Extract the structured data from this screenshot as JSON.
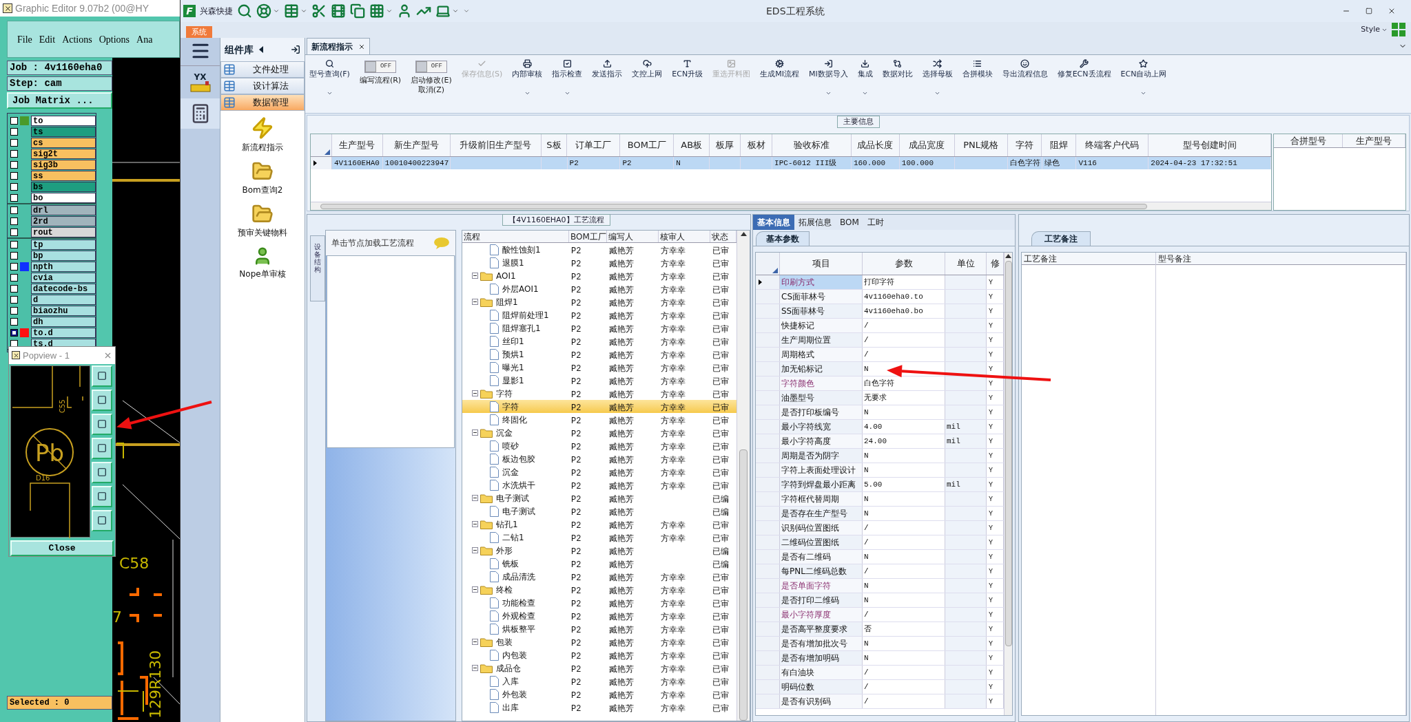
{
  "editor": {
    "title": "Graphic Editor 9.07b2 (00@HY",
    "menu": [
      "File",
      "Edit",
      "Actions",
      "Options",
      "Ana"
    ],
    "job": "Job : 4v1160eha0",
    "step": "Step: cam",
    "matrix_button": "Job Matrix ...",
    "layer_groups": [
      [
        {
          "name": "to",
          "color": "#ffffff",
          "marker": {
            "color": "#4a9a2a"
          },
          "checked": false
        },
        {
          "name": "ts",
          "color": "#1e9e80",
          "checked": false
        },
        {
          "name": "cs",
          "color": "#f8c060",
          "checked": false
        },
        {
          "name": "sig2t",
          "color": "#f8c060",
          "checked": false
        },
        {
          "name": "sig3b",
          "color": "#f8c060",
          "checked": false
        },
        {
          "name": "ss",
          "color": "#f8c060",
          "checked": false
        },
        {
          "name": "bs",
          "color": "#1e9e80",
          "checked": false
        },
        {
          "name": "bo",
          "color": "#ffffff",
          "checked": false
        }
      ],
      [
        {
          "name": "drl",
          "color": "#a0b4bc",
          "checked": false
        },
        {
          "name": "2rd",
          "color": "#a0b4bc",
          "checked": false
        },
        {
          "name": "rout",
          "color": "#d8d8d8",
          "checked": false
        }
      ],
      [
        {
          "name": "tp",
          "color": "#a8e0e0",
          "checked": false
        },
        {
          "name": "bp",
          "color": "#a8e0e0",
          "checked": false
        },
        {
          "name": "npth",
          "color": "#a8e0e0",
          "marker": {
            "color": "#1030ff"
          },
          "checked": false
        },
        {
          "name": "cvia",
          "color": "#a8e0e0",
          "checked": false
        },
        {
          "name": "datecode-bs",
          "color": "#a8e0e0",
          "checked": false
        },
        {
          "name": "d",
          "color": "#a8e0e0",
          "checked": false
        },
        {
          "name": "biaozhu",
          "color": "#a8e0e0",
          "checked": false
        },
        {
          "name": "dh",
          "color": "#a8e0e0",
          "checked": false
        },
        {
          "name": "to.d",
          "color": "#a8e0e0",
          "marker": {
            "color": "#ff1010"
          },
          "checked": true
        },
        {
          "name": "ts.d",
          "color": "#a8e0e0",
          "checked": false
        }
      ]
    ],
    "canvas_labels": [
      "C58",
      "7",
      "129R130"
    ],
    "popview": {
      "title": "Popview - 1",
      "labels": [
        "C55",
        "D16"
      ],
      "symbol": "Pb",
      "close": "Close"
    },
    "status": "Selected : 0"
  },
  "app": {
    "logo_letter": "F",
    "quick_label": "兴森快捷",
    "title": "EDS工程系统",
    "system_tab": "系统",
    "style_menu": "Style",
    "nav_logo_text": "YX"
  },
  "library": {
    "title": "组件库",
    "categories": [
      {
        "label": "文件处理",
        "selected": false
      },
      {
        "label": "设计算法",
        "selected": false
      },
      {
        "label": "数据管理",
        "selected": true
      }
    ],
    "items": [
      "新流程指示",
      "Bom查询2",
      "预审关键物料",
      "Nope单审核"
    ]
  },
  "doc_tabs": [
    {
      "label": "新流程指示",
      "selected": true
    }
  ],
  "ribbon": [
    {
      "kind": "button",
      "label": "型号查询(F)",
      "dropdown": true,
      "disabled": false
    },
    {
      "kind": "toggle",
      "label": "编写流程(R)",
      "state": "OFF",
      "on": false
    },
    {
      "kind": "toggle",
      "label": "启动修改(E)",
      "sub": "取消(Z)",
      "state": "OFF",
      "on": false
    },
    {
      "kind": "button",
      "label": "保存信息(S)",
      "dropdown": false,
      "disabled": true
    },
    {
      "kind": "button",
      "label": "内部审核",
      "dropdown": true,
      "disabled": false
    },
    {
      "kind": "button",
      "label": "指示检查",
      "dropdown": true,
      "disabled": false
    },
    {
      "kind": "button",
      "label": "发送指示",
      "dropdown": false,
      "disabled": false
    },
    {
      "kind": "button",
      "label": "文控上网",
      "dropdown": false,
      "disabled": false
    },
    {
      "kind": "button",
      "label": "ECN升级",
      "dropdown": false,
      "disabled": false
    },
    {
      "kind": "button",
      "label": "重选开料图",
      "dropdown": false,
      "disabled": true
    },
    {
      "kind": "button",
      "label": "生成MI流程",
      "dropdown": false,
      "disabled": false
    },
    {
      "kind": "button",
      "label": "MI数据导入",
      "dropdown": true,
      "disabled": false
    },
    {
      "kind": "button",
      "label": "集成",
      "dropdown": true,
      "disabled": false
    },
    {
      "kind": "button",
      "label": "数据对比",
      "dropdown": false,
      "disabled": false
    },
    {
      "kind": "button",
      "label": "选择母板",
      "dropdown": true,
      "disabled": false
    },
    {
      "kind": "button",
      "label": "合拼模块",
      "dropdown": false,
      "disabled": false
    },
    {
      "kind": "button",
      "label": "导出流程信息",
      "dropdown": false,
      "disabled": false
    },
    {
      "kind": "button",
      "label": "修复ECN丢流程",
      "dropdown": false,
      "disabled": false
    },
    {
      "kind": "button",
      "label": "ECN自动上网",
      "dropdown": true,
      "disabled": false
    }
  ],
  "main_info": {
    "title": "主要信息",
    "columns": [
      "生产型号",
      "新生产型号",
      "升级前旧生产型号",
      "S板",
      "订单工厂",
      "BOM工厂",
      "AB板",
      "板厚",
      "板材",
      "验收标准",
      "成品长度",
      "成品宽度",
      "PNL规格",
      "字符",
      "阻焊",
      "终端客户代码",
      "型号创建时间"
    ],
    "rows": [
      {
        "selected": true,
        "cells": [
          "4V1160EHA0",
          "10010400223947",
          null,
          null,
          "P2",
          "P2",
          "N",
          null,
          null,
          "IPC-6012 III级",
          "160.000",
          "100.000",
          null,
          "白色字符",
          "绿色",
          "V116",
          "2024-04-23 17:32:51"
        ]
      }
    ],
    "side_columns": [
      "合拼型号",
      "生产型号"
    ]
  },
  "flow": {
    "title": "【4V1160EHA0】工艺流程",
    "side_tab": "设备结构",
    "hint": "单击节点加载工艺流程",
    "columns": [
      "流程",
      "BOM工厂",
      "编写人",
      "核审人",
      "状态"
    ],
    "tree": [
      {
        "kind": "continued",
        "children": [
          {
            "kind": "doc",
            "name": "酸性蚀刻1",
            "factory": "P2",
            "writer": "臧艳芳",
            "reviewer": "方幸幸",
            "status": "已审",
            "selected": false
          },
          {
            "kind": "doc",
            "name": "退膜1",
            "factory": "P2",
            "writer": "臧艳芳",
            "reviewer": "方幸幸",
            "status": "已审",
            "selected": false
          }
        ]
      },
      {
        "kind": "folder",
        "name": "AOI1",
        "factory": "P2",
        "writer": "臧艳芳",
        "reviewer": "方幸幸",
        "status": "已审",
        "selected": false,
        "expanded": true,
        "children": [
          {
            "kind": "doc",
            "name": "外层AOI1",
            "factory": "P2",
            "writer": "臧艳芳",
            "reviewer": "方幸幸",
            "status": "已审",
            "selected": false
          }
        ]
      },
      {
        "kind": "folder",
        "name": "阻焊1",
        "factory": "P2",
        "writer": "臧艳芳",
        "reviewer": "方幸幸",
        "status": "已审",
        "selected": false,
        "expanded": true,
        "children": [
          {
            "kind": "doc",
            "name": "阻焊前处理1",
            "factory": "P2",
            "writer": "臧艳芳",
            "reviewer": "方幸幸",
            "status": "已审",
            "selected": false
          },
          {
            "kind": "doc",
            "name": "阻焊塞孔1",
            "factory": "P2",
            "writer": "臧艳芳",
            "reviewer": "方幸幸",
            "status": "已审",
            "selected": false
          },
          {
            "kind": "doc",
            "name": "丝印1",
            "factory": "P2",
            "writer": "臧艳芳",
            "reviewer": "方幸幸",
            "status": "已审",
            "selected": false
          },
          {
            "kind": "doc",
            "name": "预烘1",
            "factory": "P2",
            "writer": "臧艳芳",
            "reviewer": "方幸幸",
            "status": "已审",
            "selected": false
          },
          {
            "kind": "doc",
            "name": "曝光1",
            "factory": "P2",
            "writer": "臧艳芳",
            "reviewer": "方幸幸",
            "status": "已审",
            "selected": false
          },
          {
            "kind": "doc",
            "name": "显影1",
            "factory": "P2",
            "writer": "臧艳芳",
            "reviewer": "方幸幸",
            "status": "已审",
            "selected": false
          }
        ]
      },
      {
        "kind": "folder",
        "name": "字符",
        "factory": "P2",
        "writer": "臧艳芳",
        "reviewer": "方幸幸",
        "status": "已审",
        "selected": false,
        "expanded": true,
        "children": [
          {
            "kind": "doc",
            "name": "字符",
            "factory": "P2",
            "writer": "臧艳芳",
            "reviewer": "方幸幸",
            "status": "已审",
            "selected": true
          },
          {
            "kind": "doc",
            "name": "终固化",
            "factory": "P2",
            "writer": "臧艳芳",
            "reviewer": "方幸幸",
            "status": "已审",
            "selected": false
          }
        ]
      },
      {
        "kind": "folder",
        "name": "沉金",
        "factory": "P2",
        "writer": "臧艳芳",
        "reviewer": "方幸幸",
        "status": "已审",
        "selected": false,
        "expanded": true,
        "children": [
          {
            "kind": "doc",
            "name": "喷砂",
            "factory": "P2",
            "writer": "臧艳芳",
            "reviewer": "方幸幸",
            "status": "已审",
            "selected": false
          },
          {
            "kind": "doc",
            "name": "板边包胶",
            "factory": "P2",
            "writer": "臧艳芳",
            "reviewer": "方幸幸",
            "status": "已审",
            "selected": false
          },
          {
            "kind": "doc",
            "name": "沉金",
            "factory": "P2",
            "writer": "臧艳芳",
            "reviewer": "方幸幸",
            "status": "已审",
            "selected": false
          },
          {
            "kind": "doc",
            "name": "水洗烘干",
            "factory": "P2",
            "writer": "臧艳芳",
            "reviewer": "方幸幸",
            "status": "已审",
            "selected": false
          }
        ]
      },
      {
        "kind": "folder",
        "name": "电子测试",
        "factory": "P2",
        "writer": "臧艳芳",
        "status": "已编",
        "selected": false,
        "expanded": true,
        "children": [
          {
            "kind": "doc",
            "name": "电子测试",
            "factory": "P2",
            "writer": "臧艳芳",
            "status": "已编",
            "selected": false
          }
        ]
      },
      {
        "kind": "folder",
        "name": "钻孔1",
        "factory": "P2",
        "writer": "臧艳芳",
        "reviewer": "方幸幸",
        "status": "已审",
        "selected": false,
        "expanded": true,
        "children": [
          {
            "kind": "doc",
            "name": "二钻1",
            "factory": "P2",
            "writer": "臧艳芳",
            "reviewer": "方幸幸",
            "status": "已审",
            "selected": false
          }
        ]
      },
      {
        "kind": "folder",
        "name": "外形",
        "factory": "P2",
        "writer": "臧艳芳",
        "status": "已编",
        "selected": false,
        "expanded": true,
        "children": [
          {
            "kind": "doc",
            "name": "铣板",
            "factory": "P2",
            "writer": "臧艳芳",
            "status": "已编",
            "selected": false
          },
          {
            "kind": "doc",
            "name": "成品清洗",
            "factory": "P2",
            "writer": "臧艳芳",
            "reviewer": "方幸幸",
            "status": "已审",
            "selected": false
          }
        ]
      },
      {
        "kind": "folder",
        "name": "终检",
        "factory": "P2",
        "writer": "臧艳芳",
        "reviewer": "方幸幸",
        "status": "已审",
        "selected": false,
        "expanded": true,
        "children": [
          {
            "kind": "doc",
            "name": "功能检查",
            "factory": "P2",
            "writer": "臧艳芳",
            "reviewer": "方幸幸",
            "status": "已审",
            "selected": false
          },
          {
            "kind": "doc",
            "name": "外观检查",
            "factory": "P2",
            "writer": "臧艳芳",
            "reviewer": "方幸幸",
            "status": "已审",
            "selected": false
          },
          {
            "kind": "doc",
            "name": "烘板整平",
            "factory": "P2",
            "writer": "臧艳芳",
            "reviewer": "方幸幸",
            "status": "已审",
            "selected": false
          }
        ]
      },
      {
        "kind": "folder",
        "name": "包装",
        "factory": "P2",
        "writer": "臧艳芳",
        "reviewer": "方幸幸",
        "status": "已审",
        "selected": false,
        "expanded": true,
        "children": [
          {
            "kind": "doc",
            "name": "内包装",
            "factory": "P2",
            "writer": "臧艳芳",
            "reviewer": "方幸幸",
            "status": "已审",
            "selected": false
          }
        ]
      },
      {
        "kind": "folder",
        "name": "成品仓",
        "factory": "P2",
        "writer": "臧艳芳",
        "reviewer": "方幸幸",
        "status": "已审",
        "selected": false,
        "expanded": true,
        "children": [
          {
            "kind": "doc",
            "name": "入库",
            "factory": "P2",
            "writer": "臧艳芳",
            "reviewer": "方幸幸",
            "status": "已审",
            "selected": false
          },
          {
            "kind": "doc",
            "name": "外包装",
            "factory": "P2",
            "writer": "臧艳芳",
            "reviewer": "方幸幸",
            "status": "已审",
            "selected": false
          },
          {
            "kind": "doc",
            "name": "出库",
            "factory": "P2",
            "writer": "臧艳芳",
            "reviewer": "方幸幸",
            "status": "已审",
            "selected": false
          }
        ]
      }
    ]
  },
  "info": {
    "tabs": [
      {
        "label": "基本信息",
        "selected": true
      },
      {
        "label": "拓展信息",
        "selected": false
      },
      {
        "label": "BOM",
        "selected": false
      },
      {
        "label": "工时",
        "selected": false
      }
    ],
    "subtab": "基本参数",
    "columns": [
      "项目",
      "参数",
      "单位",
      "修"
    ],
    "rows": [
      {
        "item": "印刷方式",
        "value": "打印字符",
        "flag": "Y",
        "highlight": true,
        "selected": true
      },
      {
        "item": "CS面菲林号",
        "value": "4v1160eha0.to",
        "flag": "Y",
        "highlight": false,
        "selected": false
      },
      {
        "item": "SS面菲林号",
        "value": "4v1160eha0.bo",
        "flag": "Y",
        "highlight": false,
        "selected": false
      },
      {
        "item": "快捷标记",
        "value": "/",
        "flag": "Y",
        "highlight": false,
        "selected": false
      },
      {
        "item": "生产周期位置",
        "value": "/",
        "flag": "Y",
        "highlight": false,
        "selected": false
      },
      {
        "item": "周期格式",
        "value": "/",
        "flag": "Y",
        "highlight": false,
        "selected": false
      },
      {
        "item": "加无铅标记",
        "value": "N",
        "flag": "Y",
        "highlight": false,
        "selected": false
      },
      {
        "item": "字符颜色",
        "value": "白色字符",
        "flag": "Y",
        "highlight": true,
        "selected": false
      },
      {
        "item": "油墨型号",
        "value": "无要求",
        "flag": "Y",
        "highlight": false,
        "selected": false
      },
      {
        "item": "是否打印板编号",
        "value": "N",
        "flag": "Y",
        "highlight": false,
        "selected": false
      },
      {
        "item": "最小字符线宽",
        "value": "4.00",
        "unit": "mil",
        "flag": "Y",
        "highlight": false,
        "selected": false
      },
      {
        "item": "最小字符高度",
        "value": "24.00",
        "unit": "mil",
        "flag": "Y",
        "highlight": false,
        "selected": false
      },
      {
        "item": "周期是否为阴字",
        "value": "N",
        "flag": "Y",
        "highlight": false,
        "selected": false
      },
      {
        "item": "字符上表面处理设计",
        "value": "N",
        "flag": "Y",
        "highlight": false,
        "selected": false
      },
      {
        "item": "字符到焊盘最小距离",
        "value": "5.00",
        "unit": "mil",
        "flag": "Y",
        "highlight": false,
        "selected": false
      },
      {
        "item": "字符框代替周期",
        "value": "N",
        "flag": "Y",
        "highlight": false,
        "selected": false
      },
      {
        "item": "是否存在生产型号",
        "value": "N",
        "flag": "Y",
        "highlight": false,
        "selected": false
      },
      {
        "item": "识别码位置图纸",
        "value": "/",
        "flag": "Y",
        "highlight": false,
        "selected": false
      },
      {
        "item": "二维码位置图纸",
        "value": "/",
        "flag": "Y",
        "highlight": false,
        "selected": false
      },
      {
        "item": "是否有二维码",
        "value": "N",
        "flag": "Y",
        "highlight": false,
        "selected": false
      },
      {
        "item": "每PNL二维码总数",
        "value": "/",
        "flag": "Y",
        "highlight": false,
        "selected": false
      },
      {
        "item": "是否单面字符",
        "value": "N",
        "flag": "Y",
        "highlight": true,
        "selected": false
      },
      {
        "item": "是否打印二维码",
        "value": "N",
        "flag": "Y",
        "highlight": false,
        "selected": false
      },
      {
        "item": "最小字符厚度",
        "value": "/",
        "flag": "Y",
        "highlight": true,
        "selected": false
      },
      {
        "item": "是否高平整度要求",
        "value": "否",
        "flag": "Y",
        "highlight": false,
        "selected": false
      },
      {
        "item": "是否有增加批次号",
        "value": "N",
        "flag": "Y",
        "highlight": false,
        "selected": false
      },
      {
        "item": "是否有增加明码",
        "value": "N",
        "flag": "Y",
        "highlight": false,
        "selected": false
      },
      {
        "item": "有白油块",
        "value": "/",
        "flag": "Y",
        "highlight": false,
        "selected": false
      },
      {
        "item": "明码位数",
        "value": "/",
        "flag": "Y",
        "highlight": false,
        "selected": false
      },
      {
        "item": "是否有识别码",
        "value": "/",
        "flag": "Y",
        "highlight": false,
        "selected": false
      }
    ]
  },
  "notes": {
    "tab": "工艺备注",
    "columns": [
      "工艺备注",
      "型号备注"
    ]
  }
}
